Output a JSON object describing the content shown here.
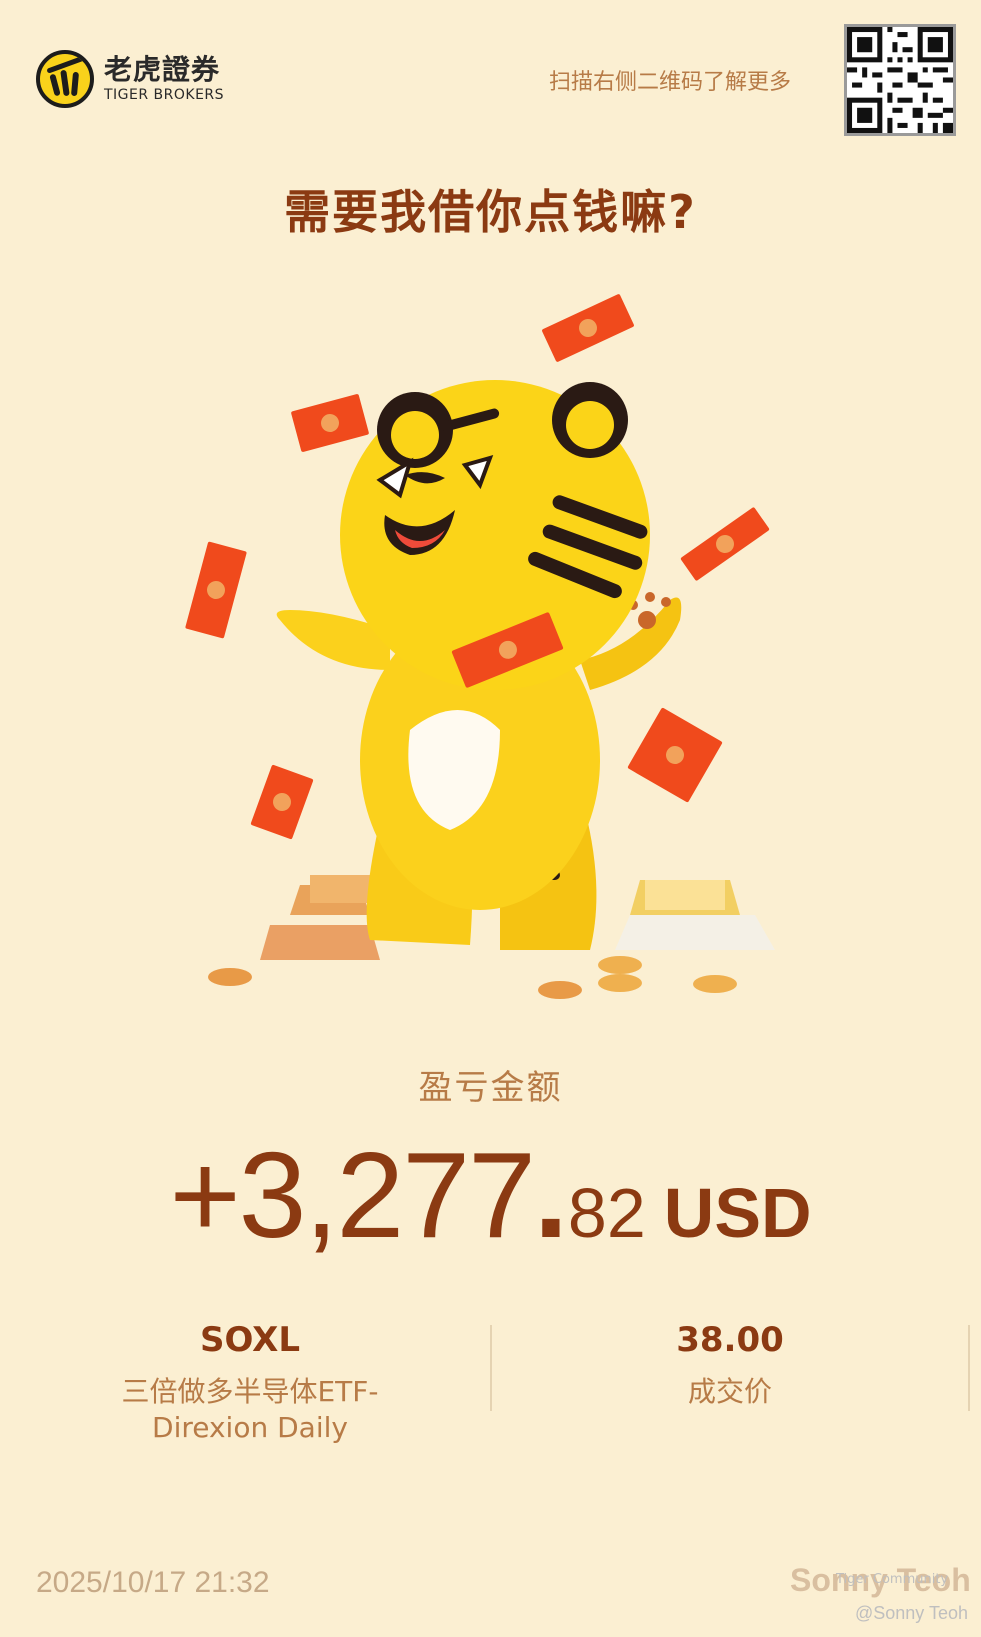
{
  "header": {
    "brand_cn": "老虎證券",
    "brand_en": "TIGER BROKERS",
    "scan_hint": "扫描右侧二维码了解更多"
  },
  "headline": "需要我借你点钱嘛?",
  "pnl": {
    "label": "盈亏金额",
    "integer": "+3,277",
    "decimal_point": ".",
    "fraction": "82",
    "currency": "USD"
  },
  "trade": {
    "ticker": "SOXL",
    "name_line1": "三倍做多半导体ETF-",
    "name_line2": "Direxion Daily",
    "price": "38.00",
    "price_label": "成交价"
  },
  "footer": {
    "datetime": "2025/10/17 21:32",
    "user": "Sonny Teoh",
    "watermark_community": "Tiger Community",
    "watermark_handle": "@Sonny Teoh"
  },
  "colors": {
    "background": "#fbefd2",
    "title": "#8b3a12",
    "muted": "#b77b47",
    "mascot_yellow": "#f9d21b",
    "envelope_red": "#f04a1c"
  },
  "icons": [
    "tiger-logo-icon",
    "qr-code-icon",
    "tiger-mascot-illustration"
  ]
}
